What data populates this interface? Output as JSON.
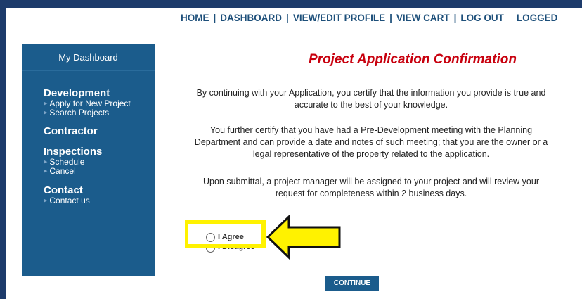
{
  "top_nav": {
    "home": "HOME",
    "dashboard": "DASHBOARD",
    "view_edit_profile": "VIEW/EDIT PROFILE",
    "view_cart": "VIEW CART",
    "log_out": "LOG OUT",
    "logged": "LOGGED"
  },
  "sidebar": {
    "header": "My Dashboard",
    "sections": [
      {
        "title": "Development",
        "items": [
          "Apply for New Project",
          "Search Projects"
        ]
      },
      {
        "title": "Contractor",
        "items": []
      },
      {
        "title": "Inspections",
        "items": [
          "Schedule",
          "Cancel"
        ]
      },
      {
        "title": "Contact",
        "items": [
          "Contact us"
        ]
      }
    ]
  },
  "main": {
    "title": "Project Application Confirmation",
    "paragraphs": [
      [
        "By continuing with your Application, you certify that the information you provide is true and",
        "accurate to the best of your knowledge."
      ],
      [
        "You further certify that you have had a Pre-Development meeting with the Planning",
        "Department and can provide a date and notes of such meeting; that you are the owner or a",
        "legal representative of the property related to the application."
      ],
      [
        "Upon submittal, a project manager will be assigned to your project and will review your",
        "request for completeness within 2 business days."
      ]
    ],
    "agree_label": "I Agree",
    "disagree_label": "I Disagree",
    "continue_label": "CONTINUE"
  },
  "colors": {
    "nav_text": "#1d4f7a",
    "sidebar_bg": "#1b5c8c",
    "title": "#c8000e",
    "highlight": "#fff200"
  }
}
